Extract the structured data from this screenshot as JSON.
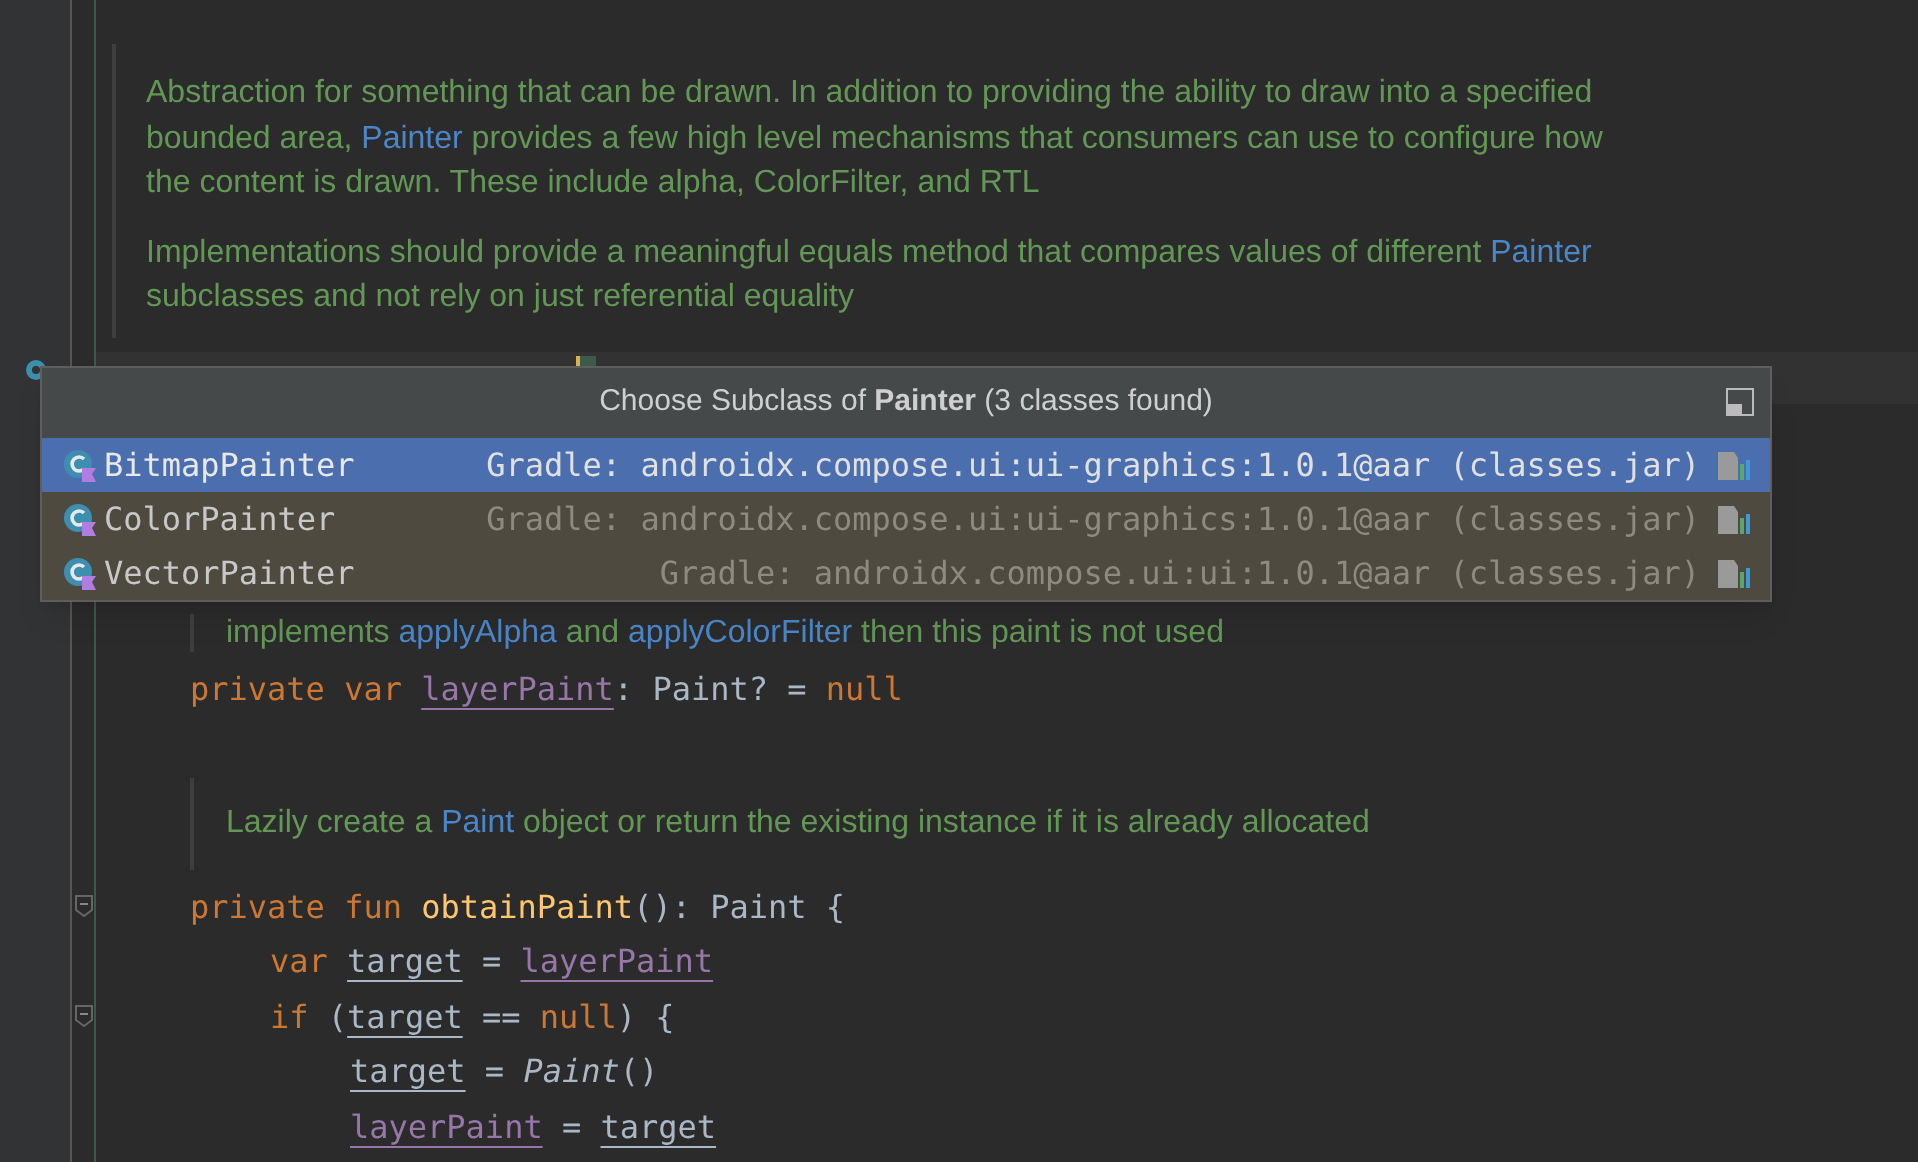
{
  "doc_comment": {
    "paragraphs": [
      {
        "lines": [
          [
            {
              "kind": "text",
              "text": "Abstraction for something that can be drawn. In addition to providing the ability to draw into a specified"
            }
          ],
          [
            {
              "kind": "text",
              "text": "bounded area, "
            },
            {
              "kind": "ref",
              "text": "Painter"
            },
            {
              "kind": "text",
              "text": " provides a few high level mechanisms that consumers can use to configure how"
            }
          ],
          [
            {
              "kind": "text",
              "text": "the content is drawn. These include alpha, ColorFilter, and RTL"
            }
          ]
        ]
      },
      {
        "lines": [
          [
            {
              "kind": "text",
              "text": "Implementations should provide a meaningful equals method that compares values of different "
            },
            {
              "kind": "ref",
              "text": "Painter"
            }
          ],
          [
            {
              "kind": "text",
              "text": "subclasses and not rely on just referential equality"
            }
          ]
        ]
      }
    ]
  },
  "popup": {
    "title": "Choose Subclass of **Painter** (3 classes found)",
    "items": [
      {
        "name": "BitmapPainter",
        "location": "Gradle: androidx.compose.ui:ui-graphics:1.0.1@aar (classes.jar)",
        "selected": true
      },
      {
        "name": "ColorPainter",
        "location": "Gradle: androidx.compose.ui:ui-graphics:1.0.1@aar (classes.jar)",
        "selected": false
      },
      {
        "name": "VectorPainter",
        "location": "Gradle: androidx.compose.ui:ui:1.0.1@aar (classes.jar)",
        "selected": false
      }
    ]
  },
  "field_comment": [
    {
      "kind": "text",
      "text": "implements "
    },
    {
      "kind": "ref",
      "text": "applyAlpha"
    },
    {
      "kind": "text",
      "text": " and "
    },
    {
      "kind": "ref",
      "text": "applyColorFilter"
    },
    {
      "kind": "text",
      "text": " then this paint is not used"
    }
  ],
  "field_line": [
    {
      "kind": "keyword",
      "text": "private var "
    },
    {
      "kind": "field",
      "text": "layerPaint"
    },
    {
      "kind": "plain",
      "text": ": Paint? = "
    },
    {
      "kind": "keyword",
      "text": "null"
    }
  ],
  "method_comment": [
    {
      "kind": "text",
      "text": "Lazily create a "
    },
    {
      "kind": "ref",
      "text": "Paint"
    },
    {
      "kind": "text",
      "text": " object or return the existing instance if it is already allocated"
    }
  ],
  "code_lines": [
    {
      "fold": true,
      "tokens": [
        {
          "kind": "keyword",
          "text": "private fun "
        },
        {
          "kind": "function",
          "text": "obtainPaint"
        },
        {
          "kind": "plain",
          "text": "(): Paint {"
        }
      ],
      "children": [
        {
          "fold": false,
          "tokens": [
            {
              "kind": "keyword",
              "text": "var "
            },
            {
              "kind": "local",
              "text": "target"
            },
            {
              "kind": "plain",
              "text": " = "
            },
            {
              "kind": "field",
              "text": "layerPaint"
            }
          ]
        },
        {
          "fold": true,
          "tokens": [
            {
              "kind": "keyword",
              "text": "if "
            },
            {
              "kind": "plain",
              "text": "("
            },
            {
              "kind": "local",
              "text": "target"
            },
            {
              "kind": "plain",
              "text": " == "
            },
            {
              "kind": "keyword",
              "text": "null"
            },
            {
              "kind": "plain",
              "text": ") {"
            }
          ],
          "children": [
            {
              "fold": false,
              "tokens": [
                {
                  "kind": "local",
                  "text": "target"
                },
                {
                  "kind": "plain",
                  "text": " = "
                },
                {
                  "kind": "italic",
                  "text": "Paint"
                },
                {
                  "kind": "plain",
                  "text": "()"
                }
              ]
            },
            {
              "fold": false,
              "tokens": [
                {
                  "kind": "field",
                  "text": "layerPaint"
                },
                {
                  "kind": "plain",
                  "text": " = "
                },
                {
                  "kind": "local",
                  "text": "target"
                }
              ]
            }
          ]
        }
      ]
    }
  ]
}
